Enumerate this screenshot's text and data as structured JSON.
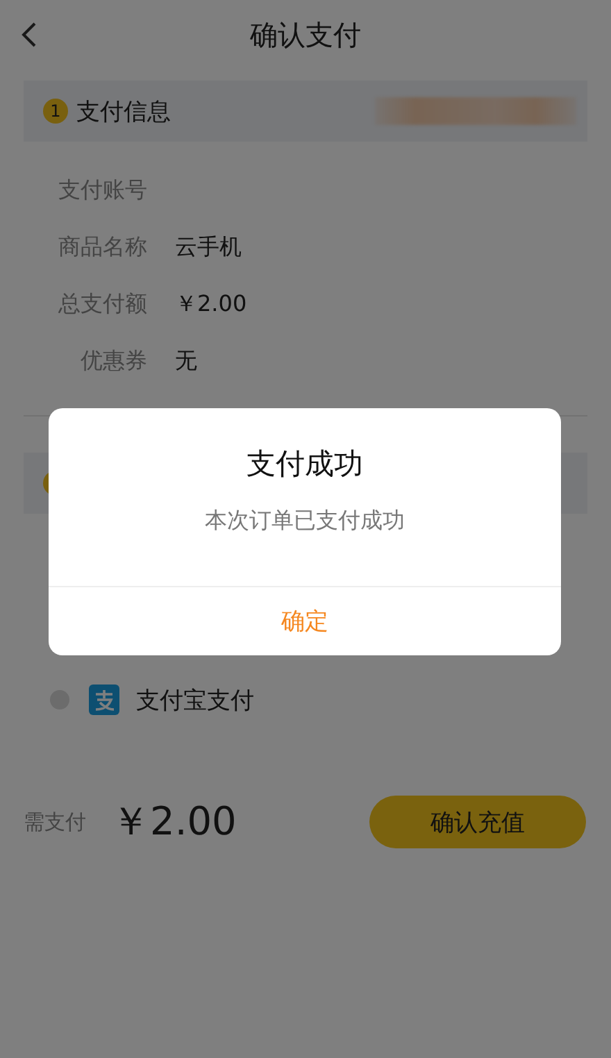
{
  "header": {
    "title": "确认支付"
  },
  "info_section": {
    "badge": "1",
    "title": "支付信息"
  },
  "info_rows": [
    {
      "label": "支付账号"
    },
    {
      "label": "商品名称",
      "value": "云手机"
    },
    {
      "label": "总支付额",
      "value": "￥2.00"
    },
    {
      "label": "优惠券",
      "value": "无"
    }
  ],
  "payment_methods": [
    {
      "name": "支付宝支付",
      "selected": false
    }
  ],
  "footer": {
    "label": "需支付",
    "amount": "￥2.00",
    "button": "确认充值"
  },
  "dialog": {
    "title": "支付成功",
    "message": "本次订单已支付成功",
    "button": "确定"
  }
}
